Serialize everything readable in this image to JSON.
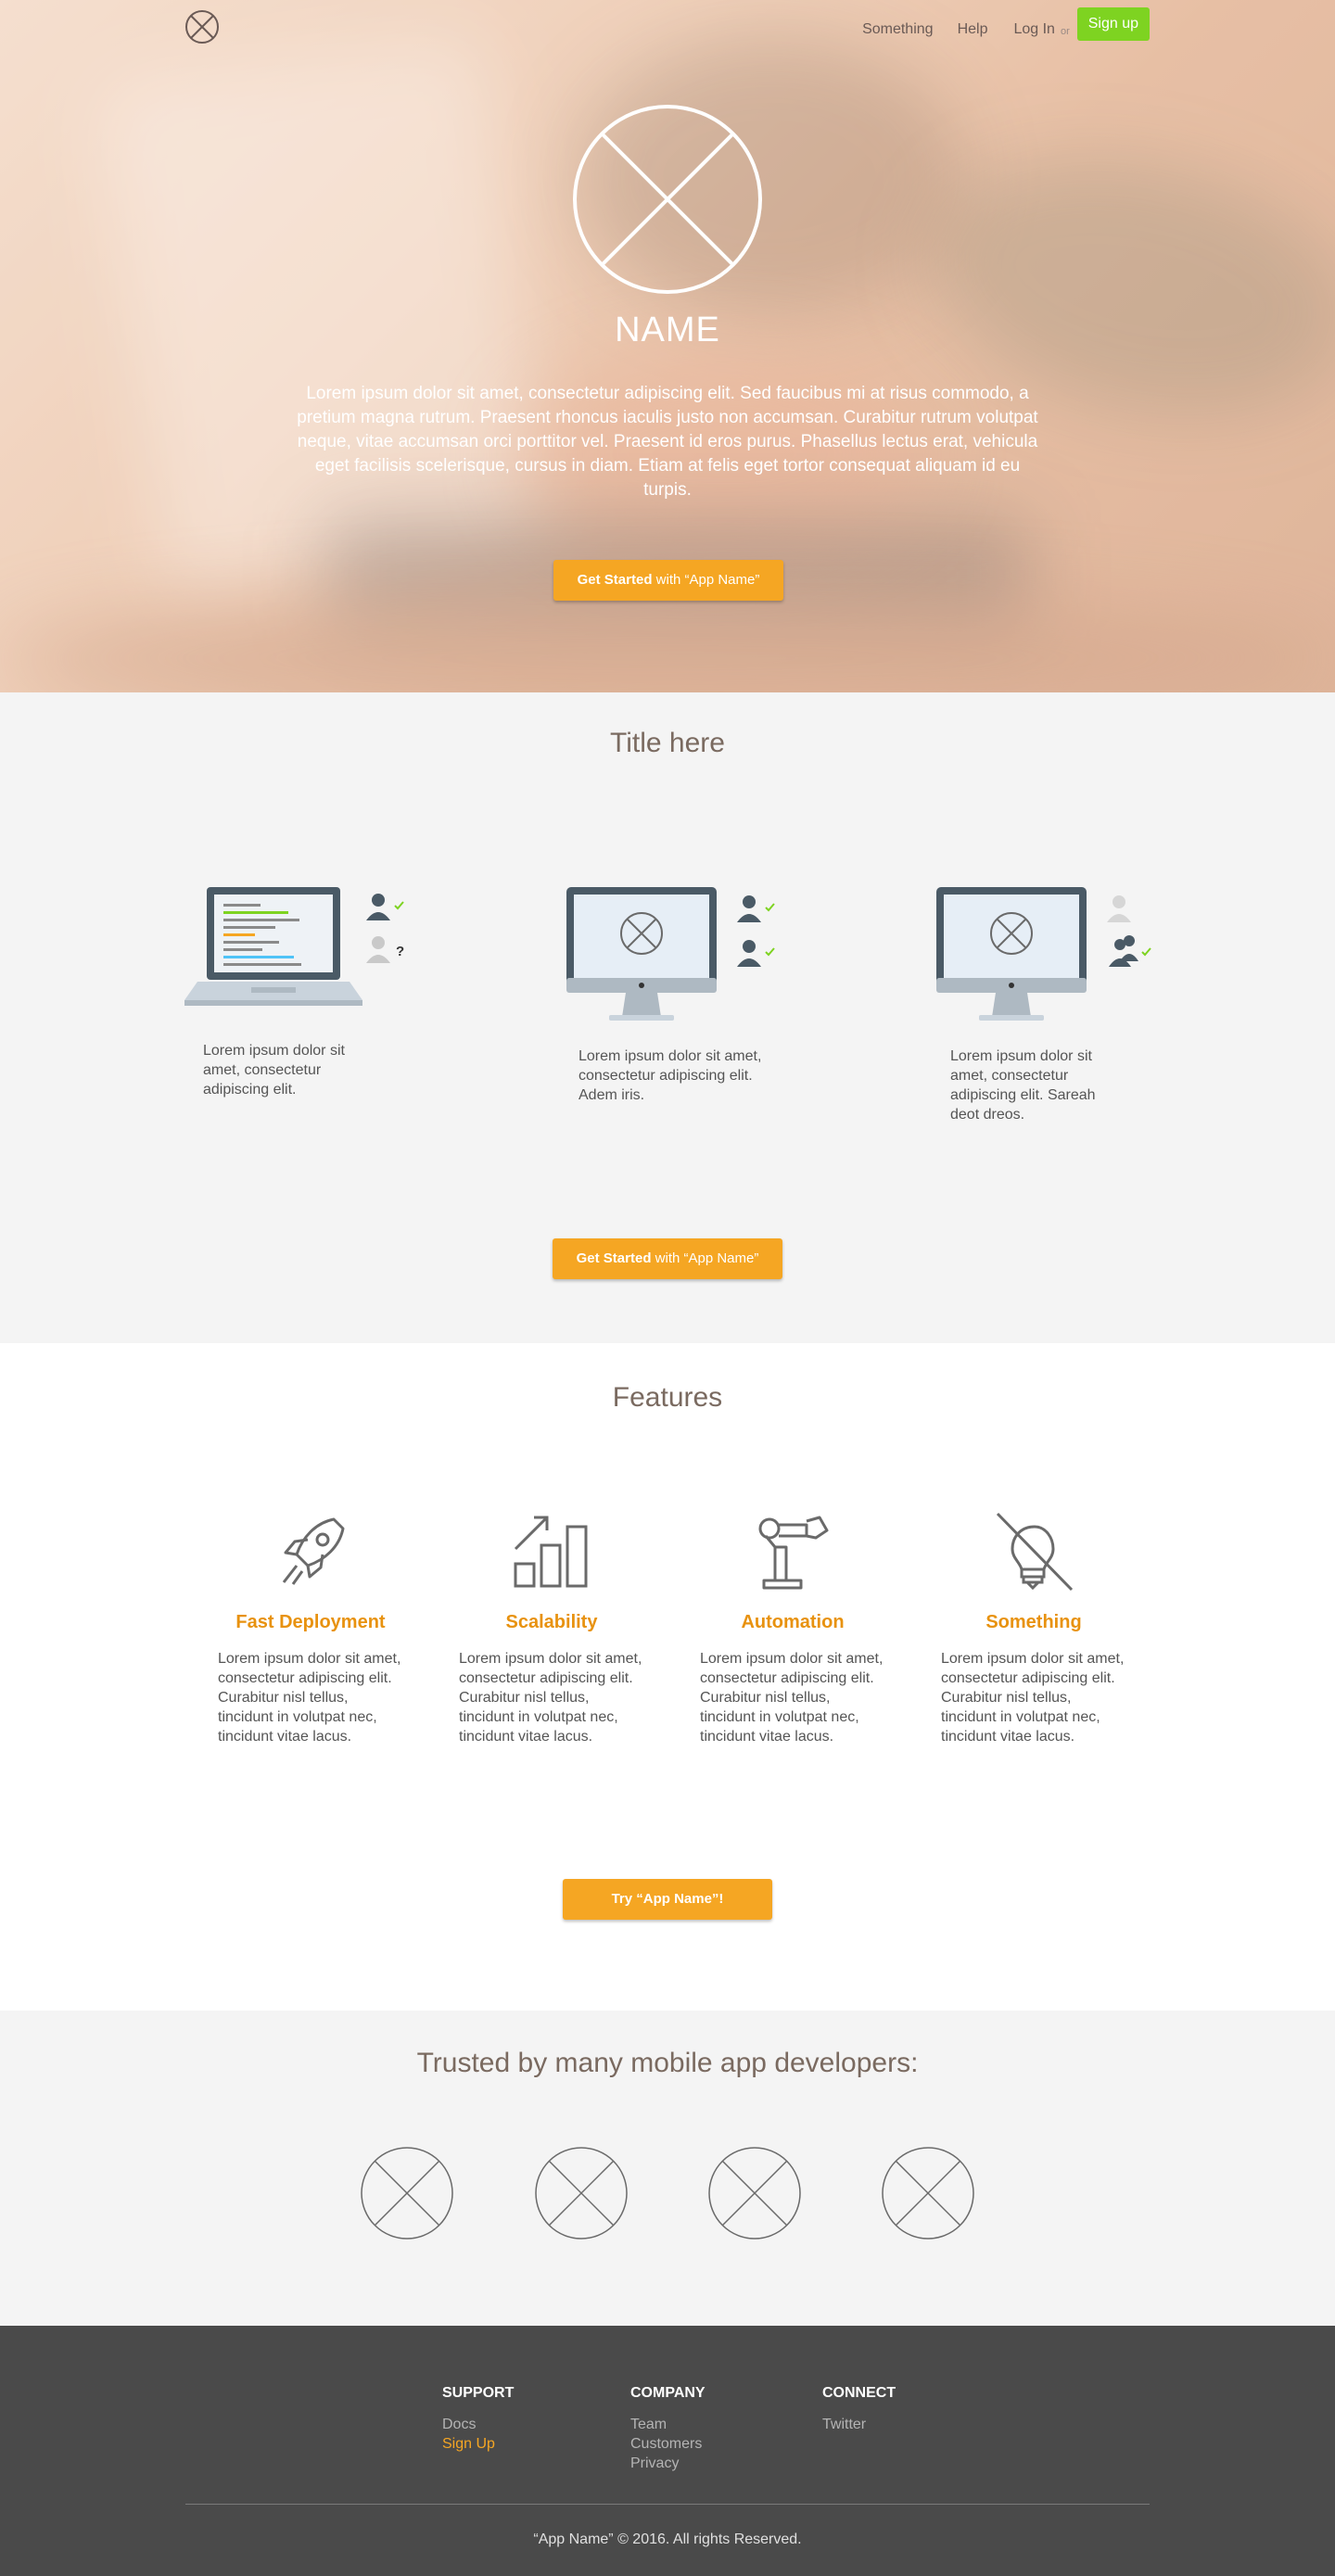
{
  "nav": {
    "links": [
      "Something",
      "Help",
      "Log In"
    ],
    "or": "or",
    "signup": "Sign up"
  },
  "hero": {
    "name": "NAME",
    "description": "Lorem ipsum dolor sit amet, consectetur adipiscing elit. Sed faucibus mi at risus commodo, a pretium magna rutrum. Praesent rhoncus iaculis justo non accumsan. Curabitur rutrum volutpat neque, vitae accumsan orci porttitor vel. Praesent id eros purus. Phasellus lectus erat, vehicula eget facilisis scelerisque, cursus in diam. Etiam at felis eget tortor consequat aliquam id eu turpis.",
    "cta_strong": "Get Started",
    "cta_rest": " with “App Name”"
  },
  "title_section": {
    "title": "Title here",
    "items": [
      "Lorem ipsum dolor sit amet, consectetur adipiscing elit.",
      "Lorem ipsum dolor sit amet, consectetur adipiscing elit. Adem iris.",
      "Lorem ipsum dolor sit amet, consectetur adipiscing elit. Sareah deot dreos."
    ],
    "cta_strong": "Get Started",
    "cta_rest": " with “App Name”"
  },
  "features": {
    "title": "Features",
    "items": [
      {
        "title": "Fast Deployment",
        "text": "Lorem ipsum dolor sit amet, consectetur adipiscing elit. Curabitur nisl tellus, tincidunt in volutpat nec, tincidunt vitae lacus.",
        "icon": "rocket-icon"
      },
      {
        "title": "Scalability",
        "text": "Lorem ipsum dolor sit amet, consectetur adipiscing elit. Curabitur nisl tellus, tincidunt in volutpat nec, tincidunt vitae lacus.",
        "icon": "bar-growth-icon"
      },
      {
        "title": "Automation",
        "text": "Lorem ipsum dolor sit amet, consectetur adipiscing elit. Curabitur nisl tellus, tincidunt in volutpat nec, tincidunt vitae lacus.",
        "icon": "robot-arm-icon"
      },
      {
        "title": "Something",
        "text": "Lorem ipsum dolor sit amet, consectetur adipiscing elit. Curabitur nisl tellus, tincidunt in volutpat nec, tincidunt vitae lacus.",
        "icon": "no-lightbulb-icon"
      }
    ],
    "cta": "Try “App Name”!"
  },
  "trusted": {
    "title": "Trusted by many mobile app developers:"
  },
  "footer": {
    "columns": [
      {
        "heading": "SUPPORT",
        "links": [
          "Docs",
          "Sign Up"
        ]
      },
      {
        "heading": "COMPANY",
        "links": [
          "Team",
          "Customers",
          "Privacy"
        ]
      },
      {
        "heading": "CONNECT",
        "links": [
          "Twitter"
        ]
      }
    ],
    "copyright": "“App Name” © 2016. All rights Reserved."
  },
  "colors": {
    "accent": "#f5a623",
    "signup": "#7ed321",
    "footer_bg": "#4a4a4a",
    "heading": "#7a6a60"
  }
}
